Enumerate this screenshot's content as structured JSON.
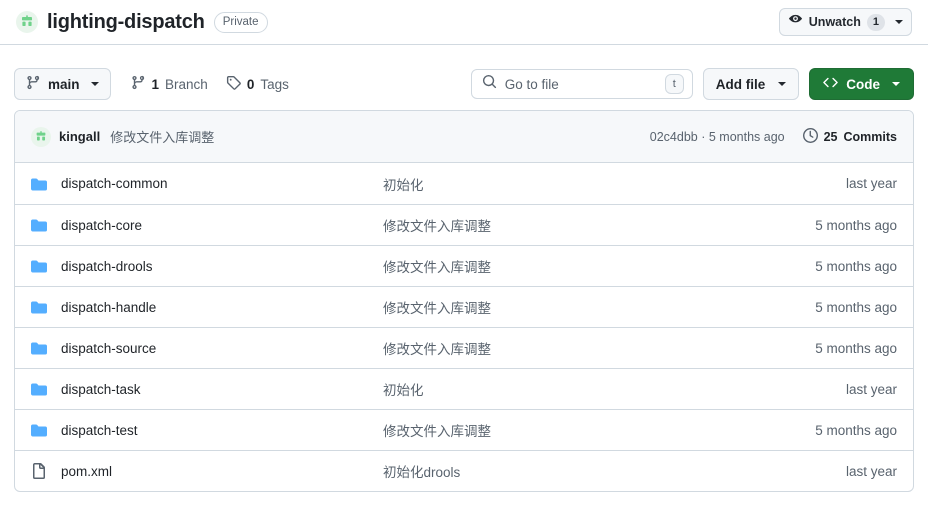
{
  "header": {
    "owner_avatar_icon": "owner-avatar-icon",
    "repo_name": "lighting-dispatch",
    "visibility_badge": "Private",
    "watch": {
      "icon": "eye-icon",
      "label": "Unwatch",
      "count": "1",
      "dropdown_icon": "chevron-down-icon"
    }
  },
  "toolbar": {
    "branch": {
      "icon": "branch-icon",
      "name": "main",
      "dropdown_icon": "chevron-down-icon"
    },
    "branch_count": {
      "icon": "branch-icon",
      "value": "1",
      "label": "Branch"
    },
    "tag_count": {
      "icon": "tag-icon",
      "value": "0",
      "label": "Tags"
    },
    "search": {
      "icon": "search-icon",
      "placeholder": "Go to file",
      "value": "",
      "shortcut": "t"
    },
    "add_file": {
      "label": "Add file",
      "dropdown_icon": "chevron-down-icon"
    },
    "code": {
      "icon": "code-icon",
      "label": "Code",
      "dropdown_icon": "chevron-down-icon",
      "color": "#1f7a37"
    }
  },
  "latest_commit": {
    "avatar_icon": "author-avatar-icon",
    "author": "kingall",
    "message": "修改文件入库调整",
    "hash_and_time": "02c4dbb · 5 months ago",
    "history_icon": "history-clock-icon",
    "commits_count": "25",
    "commits_label": "Commits"
  },
  "files": [
    {
      "icon": "folder-icon",
      "type": "folder",
      "name": "dispatch-common",
      "message": "初始化",
      "time": "last year"
    },
    {
      "icon": "folder-icon",
      "type": "folder",
      "name": "dispatch-core",
      "message": "修改文件入库调整",
      "time": "5 months ago"
    },
    {
      "icon": "folder-icon",
      "type": "folder",
      "name": "dispatch-drools",
      "message": "修改文件入库调整",
      "time": "5 months ago"
    },
    {
      "icon": "folder-icon",
      "type": "folder",
      "name": "dispatch-handle",
      "message": "修改文件入库调整",
      "time": "5 months ago"
    },
    {
      "icon": "folder-icon",
      "type": "folder",
      "name": "dispatch-source",
      "message": "修改文件入库调整",
      "time": "5 months ago"
    },
    {
      "icon": "folder-icon",
      "type": "folder",
      "name": "dispatch-task",
      "message": "初始化",
      "time": "last year"
    },
    {
      "icon": "folder-icon",
      "type": "folder",
      "name": "dispatch-test",
      "message": "修改文件入库调整",
      "time": "5 months ago"
    },
    {
      "icon": "file-icon",
      "type": "file",
      "name": "pom.xml",
      "message": "初始化drools",
      "time": "last year"
    }
  ],
  "colors": {
    "folder_blue": "#54aeff",
    "code_green": "#1f7a37",
    "border": "#d1d9e0",
    "muted_text": "#59636e",
    "surface": "#f6f8fa"
  }
}
